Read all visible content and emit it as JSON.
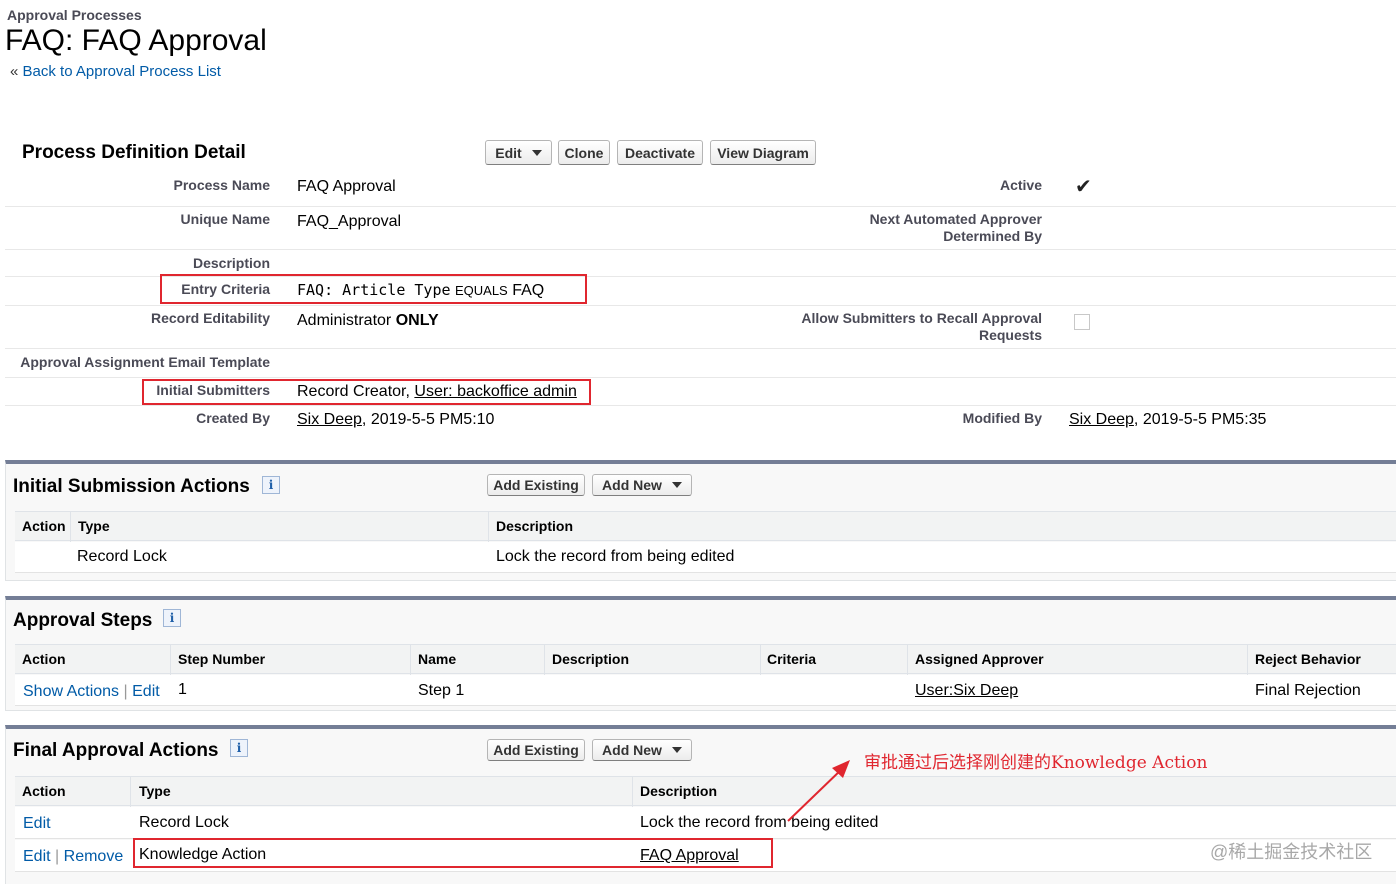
{
  "header": {
    "breadcrumb": "Approval Processes",
    "title": "FAQ: FAQ Approval",
    "back_prefix": "«",
    "back_link": "Back to Approval Process List"
  },
  "detail": {
    "title": "Process Definition Detail",
    "buttons": {
      "edit": "Edit",
      "clone": "Clone",
      "deactivate": "Deactivate",
      "view_diagram": "View Diagram"
    },
    "fields": {
      "process_name_label": "Process Name",
      "process_name_value": "FAQ Approval",
      "active_label": "Active",
      "unique_name_label": "Unique Name",
      "unique_name_value": "FAQ_Approval",
      "next_approver_label_1": "Next Automated Approver",
      "next_approver_label_2": "Determined By",
      "description_label": "Description",
      "entry_criteria_label": "Entry Criteria",
      "entry_criteria_field": "FAQ: Article Type",
      "entry_criteria_operator": "EQUALS",
      "entry_criteria_value": "FAQ",
      "record_editability_label": "Record Editability",
      "record_editability_value_1": "Administrator",
      "record_editability_value_2": "ONLY",
      "allow_recall_label_1": "Allow Submitters to Recall Approval",
      "allow_recall_label_2": "Requests",
      "email_template_label": "Approval Assignment Email Template",
      "initial_submitters_label": "Initial Submitters",
      "initial_submitters_prefix": "Record Creator,",
      "initial_submitters_link": "User: backoffice admin",
      "created_by_label": "Created By",
      "created_by_user": "Six Deep",
      "created_by_date": ", 2019-5-5 PM5:10",
      "modified_by_label": "Modified By",
      "modified_by_user": "Six Deep",
      "modified_by_date": ", 2019-5-5 PM5:35"
    },
    "active_check": "✔"
  },
  "initial_submission": {
    "title": "Initial Submission Actions",
    "info": "i",
    "add_existing": "Add Existing",
    "add_new": "Add New",
    "columns": [
      "Action",
      "Type",
      "Description"
    ],
    "rows": [
      {
        "type": "Record Lock",
        "description": "Lock the record from being edited"
      }
    ]
  },
  "approval_steps": {
    "title": "Approval Steps",
    "info": "i",
    "columns": [
      "Action",
      "Step Number",
      "Name",
      "Description",
      "Criteria",
      "Assigned Approver",
      "Reject Behavior"
    ],
    "rows": [
      {
        "show_actions": "Show Actions",
        "divider": "|",
        "edit": "Edit",
        "step": "1",
        "name": "Step 1",
        "approver": "User:Six Deep",
        "reject": "Final Rejection"
      }
    ]
  },
  "final_approval": {
    "title": "Final Approval Actions",
    "info": "i",
    "add_existing": "Add Existing",
    "add_new": "Add New",
    "columns": [
      "Action",
      "Type",
      "Description"
    ],
    "rows": [
      {
        "edit": "Edit",
        "type": "Record Lock",
        "description": "Lock the record from being edited"
      },
      {
        "edit": "Edit",
        "divider": "|",
        "remove": "Remove",
        "type": "Knowledge Action",
        "description": "FAQ Approval"
      }
    ]
  },
  "annotation": {
    "text": "审批通过后选择刚创建的Knowledge Action",
    "color": "#e0262f"
  },
  "watermark": {
    "text": "@稀土掘金技术社区"
  },
  "colors": {
    "link": "#015ba7",
    "section_border": "#747e96",
    "highlight": "#e0262f"
  }
}
